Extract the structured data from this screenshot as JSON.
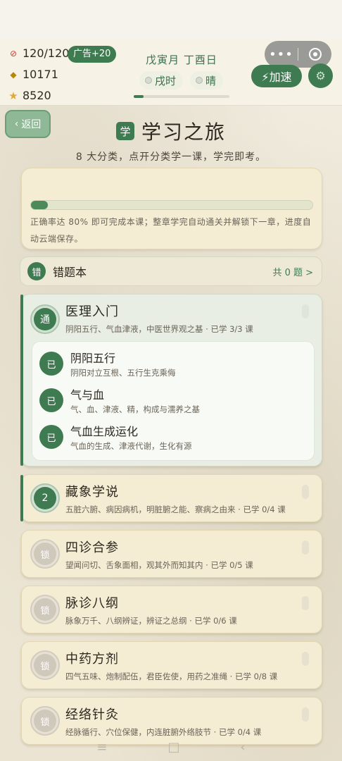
{
  "header": {
    "energy": "120/120",
    "ad_badge": "广告+20",
    "coins": "10171",
    "stars": "8520",
    "date": "戊寅月 丁酉日",
    "time_chip": "戌时",
    "weather_chip": "晴",
    "speed_label": "⚡加速",
    "time_progress": 0.1
  },
  "capsule": {
    "more": "•••"
  },
  "page": {
    "back_label": "返回",
    "title_badge": "学",
    "title": "学习之旅",
    "subtitle": "8 大分类，点开分类学一课，学完即考。"
  },
  "progress": {
    "fraction": 0.06,
    "note": "正确率达 80% 即可完成本课；整章学完自动通关并解锁下一章，进度自动云端保存。"
  },
  "mistakes": {
    "badge": "错",
    "label": "错题本",
    "count": "共 0 题  >"
  },
  "categories": [
    {
      "badge": "通",
      "title": "医理入门",
      "desc": "阴阳五行、气血津液，中医世界观之基 · 已学 3/3 课",
      "lessons": [
        {
          "badge": "已",
          "title": "阴阳五行",
          "desc": "阴阳对立互根、五行生克乘侮"
        },
        {
          "badge": "已",
          "title": "气与血",
          "desc": "气、血、津液、精，构成与濡养之基"
        },
        {
          "badge": "已",
          "title": "气血生成运化",
          "desc": "气血的生成、津液代谢，生化有源"
        }
      ]
    },
    {
      "badge": "2",
      "title": "藏象学说",
      "desc": "五脏六腑、病因病机，明脏腑之能、察病之由来 · 已学 0/4 课"
    },
    {
      "badge": "锁",
      "title": "四诊合参",
      "desc": "望闻问切、舌象面相，观其外而知其内 · 已学 0/5 课"
    },
    {
      "badge": "锁",
      "title": "脉诊八纲",
      "desc": "脉象万千、八纲辨证，辨证之总纲 · 已学 0/6 课"
    },
    {
      "badge": "锁",
      "title": "中药方剂",
      "desc": "四气五味、炮制配伍，君臣佐使，用药之准绳 · 已学 0/8 课"
    },
    {
      "badge": "锁",
      "title": "经络针灸",
      "desc": "经脉循行、穴位保健，内连脏腑外络肢节 · 已学 0/4 课"
    }
  ],
  "navbar": {
    "menu": "≡",
    "home": "□",
    "back": "‹"
  }
}
